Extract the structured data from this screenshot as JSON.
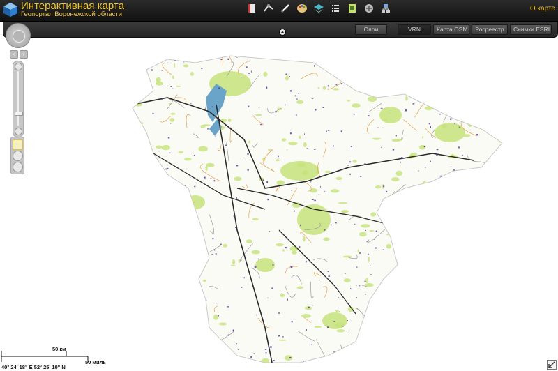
{
  "header": {
    "title": "Интерактивная карта",
    "subtitle": "Геопортал Воронежской области",
    "about_link": "О карте",
    "tool_icons": [
      "book-icon",
      "measure-icon",
      "pencil-icon",
      "palette-icon",
      "globe-layers-icon",
      "list-icon",
      "print-icon",
      "satellite-icon",
      "network-icon"
    ]
  },
  "layer_bar": {
    "layers_button": "Слои",
    "basemaps": [
      {
        "label": "VRN",
        "active": true
      },
      {
        "label": "Карта OSM",
        "active": false
      },
      {
        "label": "Росреестр",
        "active": false
      },
      {
        "label": "Снимки ESRI",
        "active": false
      }
    ]
  },
  "scale": {
    "km_label": "50 км",
    "mi_label": "50 миль"
  },
  "coordinates": "40° 24' 18\" E 52° 25' 10\" N",
  "colors": {
    "accent": "#f0c62a",
    "forest": "#c6e27a",
    "water": "#6aa4c8",
    "roads_major": "#2a2a2a",
    "roads_minor": "#e8a04a",
    "settlements": "#5a3a9a"
  }
}
